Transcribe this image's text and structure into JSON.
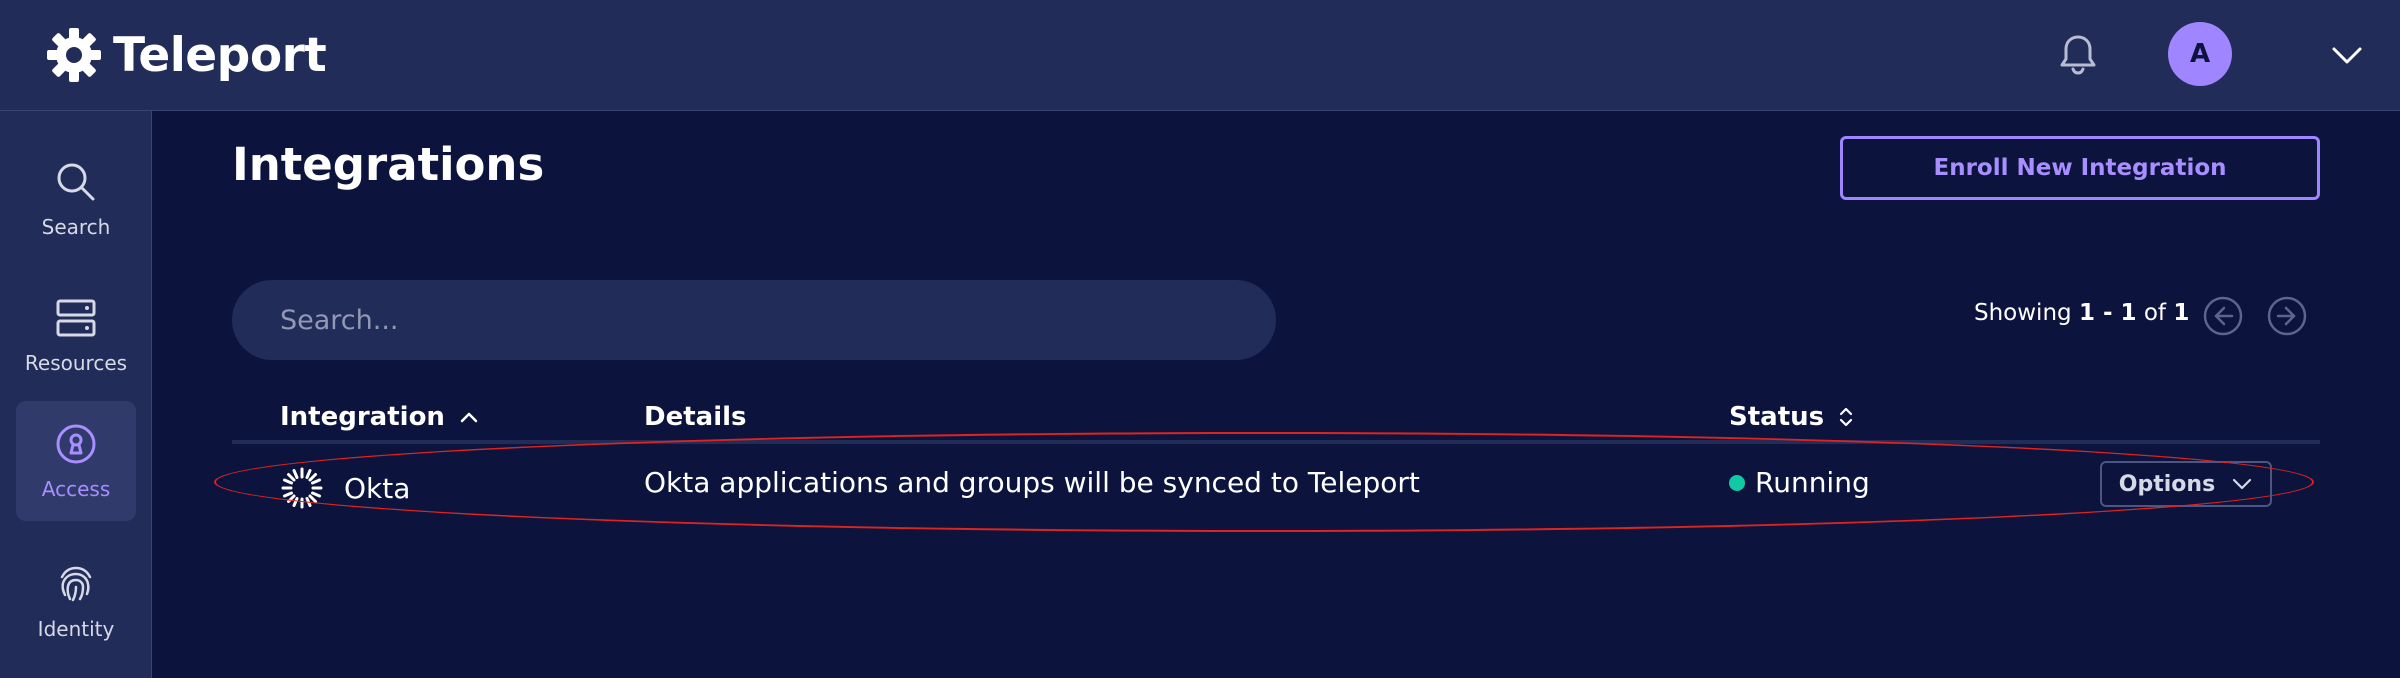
{
  "app": {
    "name": "Teleport"
  },
  "header": {
    "avatar_initial": "A"
  },
  "sidebar": {
    "items": [
      {
        "label": "Search"
      },
      {
        "label": "Resources"
      },
      {
        "label": "Access",
        "active": true
      },
      {
        "label": "Identity"
      }
    ]
  },
  "page": {
    "title": "Integrations",
    "enroll_label": "Enroll New Integration",
    "search_placeholder": "Search...",
    "pagination": {
      "prefix": "Showing",
      "range": "1 - 1",
      "of_label": "of",
      "total": "1"
    }
  },
  "table": {
    "columns": [
      "Integration",
      "Details",
      "Status"
    ],
    "rows": [
      {
        "integration": "Okta",
        "details": "Okta applications and groups will be synced to Teleport",
        "status": "Running",
        "status_color": "#12c9a5",
        "options_label": "Options"
      }
    ]
  },
  "colors": {
    "accent": "#9f85ff",
    "background": "#0c143d",
    "panel": "#222c59",
    "annotation": "#e0231e"
  }
}
